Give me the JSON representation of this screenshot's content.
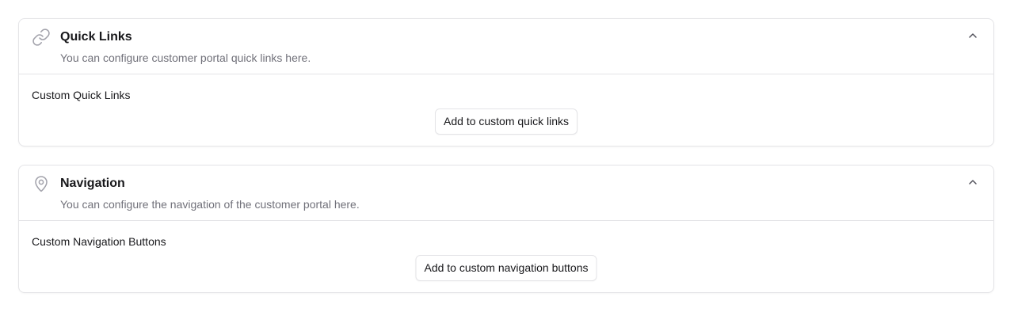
{
  "quick_links": {
    "icon": "link-icon",
    "title": "Quick Links",
    "description": "You can configure customer portal quick links here.",
    "collapse_icon": "chevron-up-icon",
    "section_label": "Custom Quick Links",
    "add_button_label": "Add to custom quick links"
  },
  "navigation": {
    "icon": "map-pin-icon",
    "title": "Navigation",
    "description": "You can configure the navigation of the customer portal here.",
    "collapse_icon": "chevron-up-icon",
    "section_label": "Custom Navigation Buttons",
    "add_button_label": "Add to custom navigation buttons"
  },
  "colors": {
    "border": "#e4e4e7",
    "text": "#18181b",
    "muted_text": "#71717a",
    "icon": "#a1a1aa"
  }
}
